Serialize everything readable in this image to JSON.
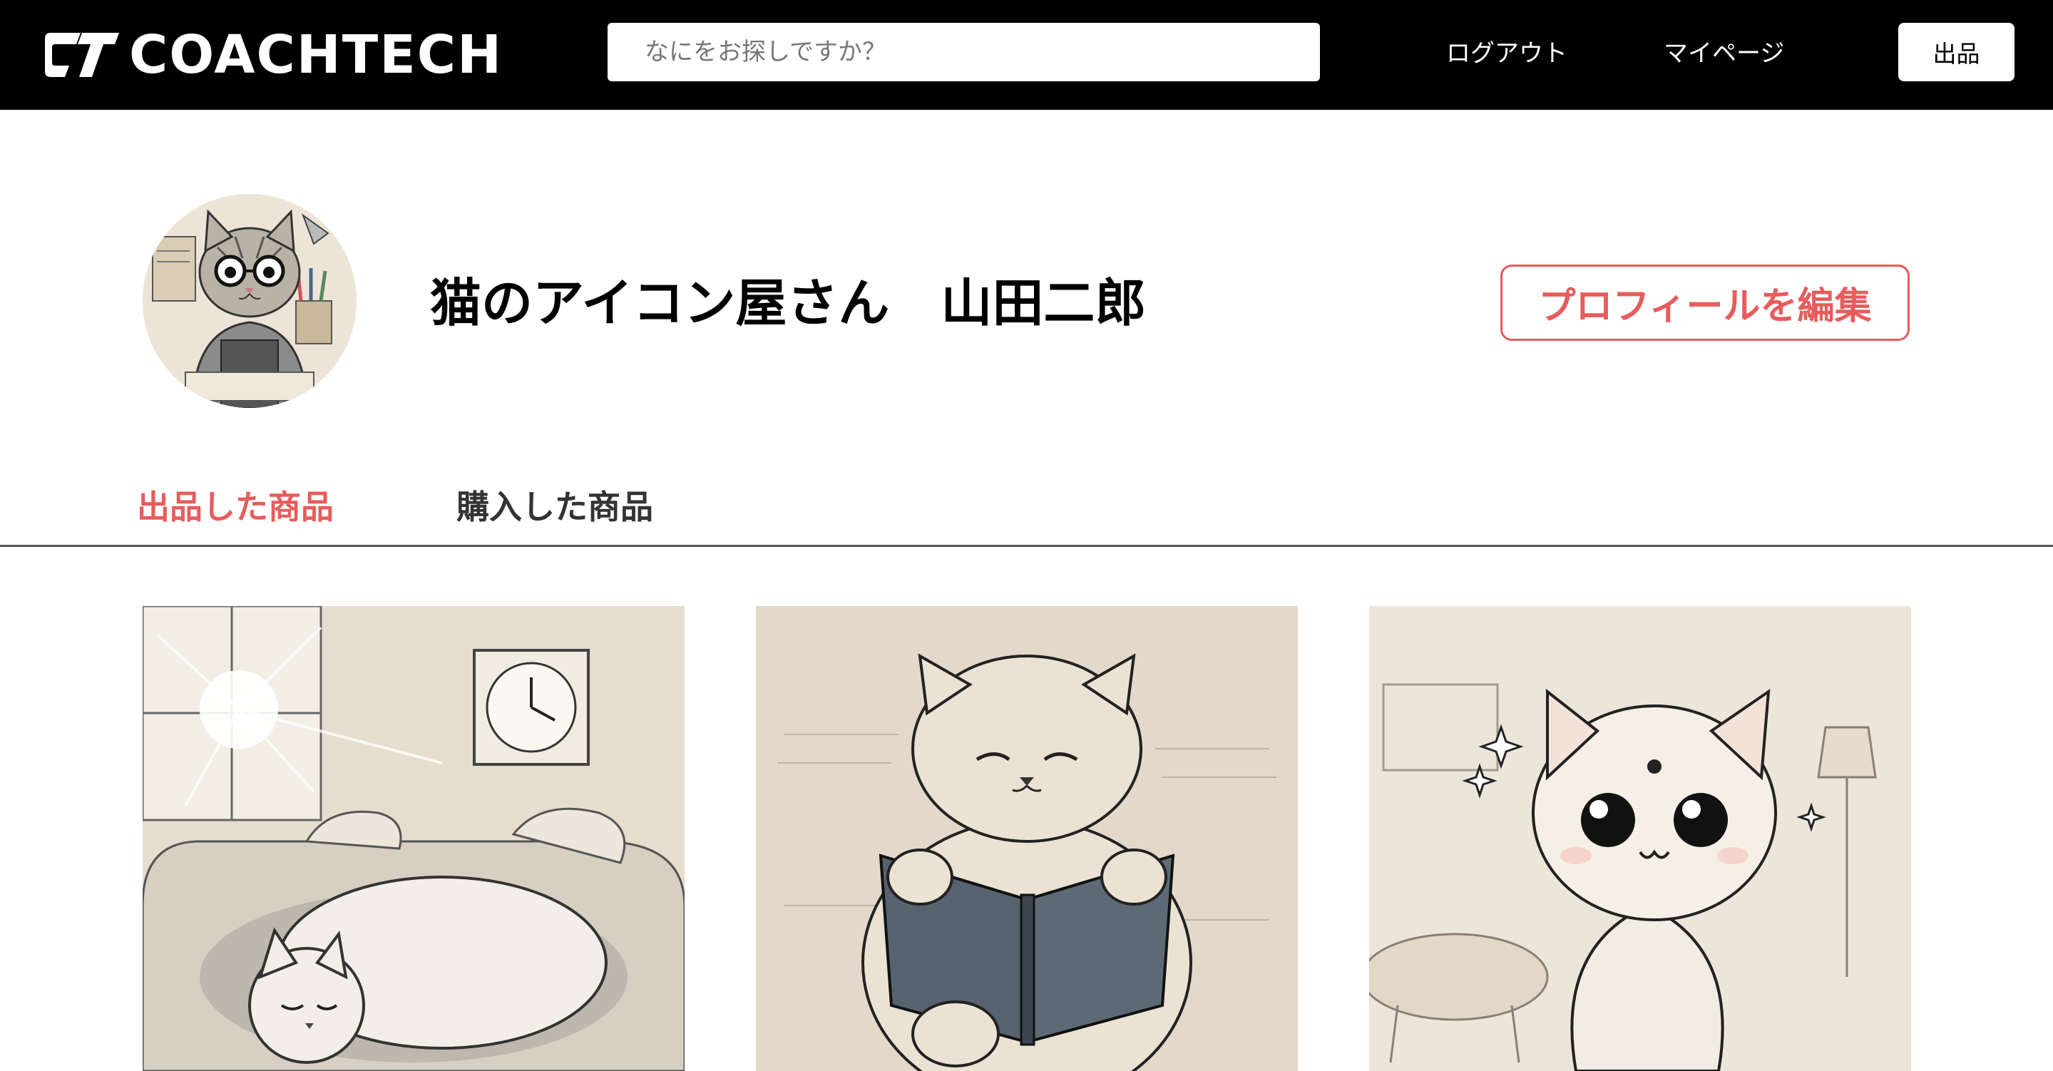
{
  "header": {
    "logo_text": "COACHTECH",
    "search_placeholder": "なにをお探しですか？",
    "logout_label": "ログアウト",
    "mypage_label": "マイページ",
    "sell_label": "出品"
  },
  "profile": {
    "user_name": "猫のアイコン屋さん　山田二郎",
    "edit_label": "プロフィールを編集"
  },
  "tabs": [
    {
      "label": "出品した商品",
      "active": true
    },
    {
      "label": "購入した商品",
      "active": false
    }
  ],
  "colors": {
    "accent": "#e75c5c",
    "header_bg": "#000000"
  },
  "products": [
    {
      "image_icon": "sleeping-cat-on-sofa-image"
    },
    {
      "image_icon": "cat-reading-book-image"
    },
    {
      "image_icon": "cute-cat-sparkles-image"
    }
  ]
}
